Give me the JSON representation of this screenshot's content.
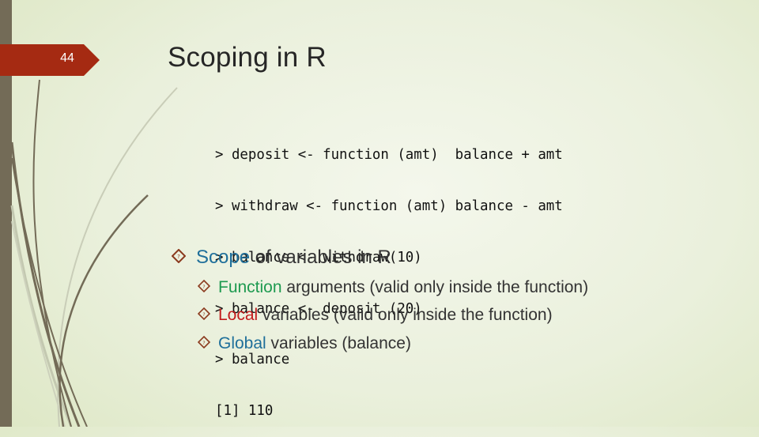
{
  "slide": {
    "number": "44",
    "title": "Scoping in R"
  },
  "code_block": {
    "lines": [
      "> deposit <- function (amt)  balance + amt",
      "> withdraw <- function (amt) balance - amt",
      "> balance <- withdraw(10)",
      "> balance <- deposit (20)",
      "> balance",
      "[1] 110"
    ]
  },
  "bullets": {
    "main": {
      "highlight": "Scope",
      "text": " of variables in R",
      "icon": "diamond-bullet-icon"
    },
    "sub": [
      {
        "highlight": "Function",
        "text": " arguments (valid only inside the function)",
        "icon": "diamond-bullet-icon"
      },
      {
        "highlight": "Local",
        "text": " variables (valid only inside the function)",
        "icon": "diamond-bullet-icon"
      },
      {
        "highlight": "Global",
        "text": " variables (balance)",
        "icon": "diamond-bullet-icon"
      }
    ]
  },
  "colors": {
    "tag": "#a52a12",
    "sidebar": "#736b57",
    "highlight_scope": "#1f6f9a",
    "highlight_function": "#1e9a50",
    "highlight_local": "#c31c1c",
    "highlight_global": "#1f6f9a",
    "bullet": "#8b3a1e"
  }
}
